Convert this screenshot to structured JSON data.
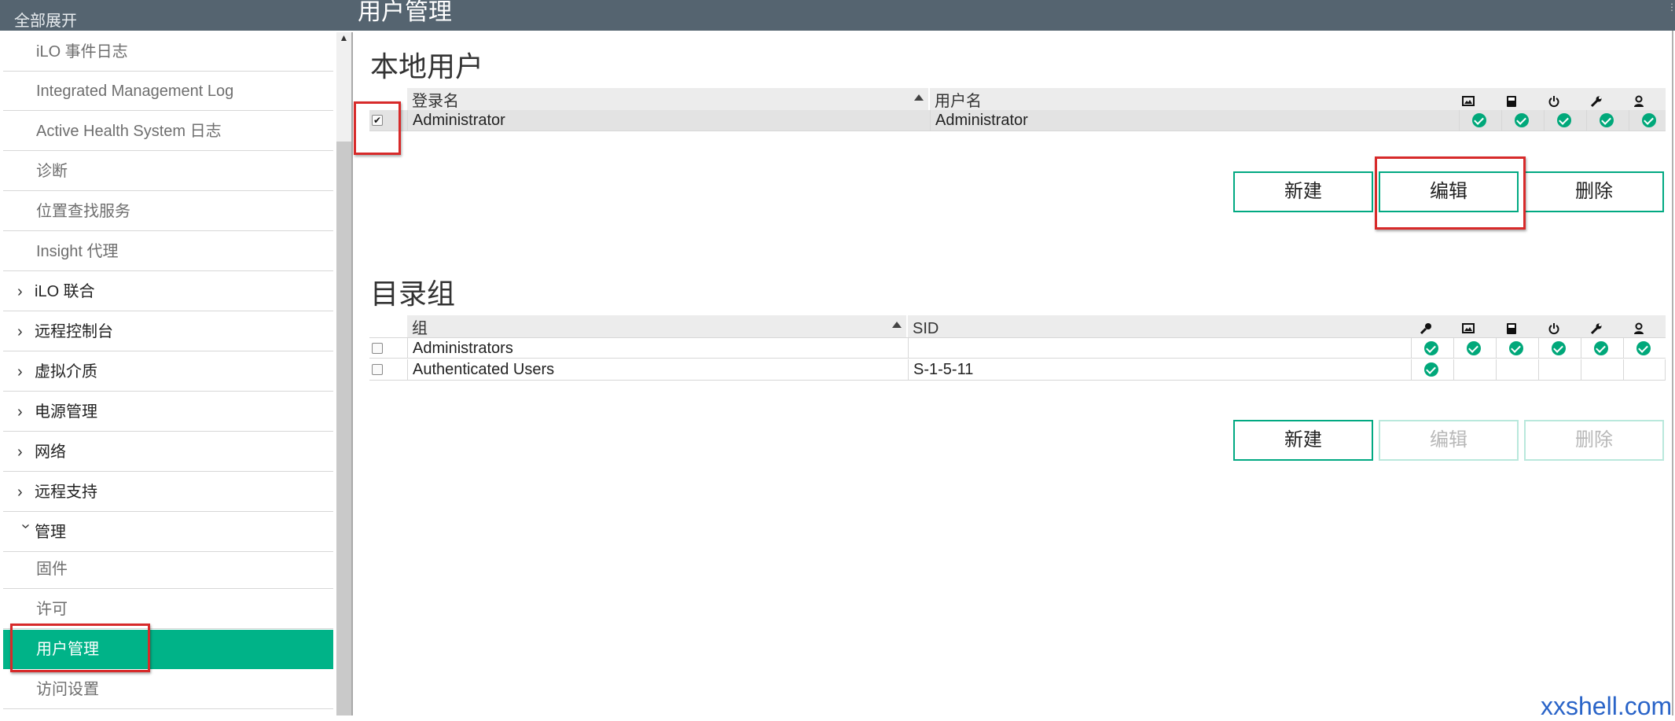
{
  "topbar": {
    "expand_all": "全部展开",
    "page_title": "用户管理"
  },
  "sidebar": {
    "items": [
      {
        "label": "iLO 事件日志",
        "kind": "child"
      },
      {
        "label": "Integrated Management Log",
        "kind": "child"
      },
      {
        "label": "Active Health System 日志",
        "kind": "child"
      },
      {
        "label": "诊断",
        "kind": "child"
      },
      {
        "label": "位置查找服务",
        "kind": "child"
      },
      {
        "label": "Insight 代理",
        "kind": "child"
      },
      {
        "label": "iLO 联合",
        "kind": "parent",
        "state": "collapsed"
      },
      {
        "label": "远程控制台",
        "kind": "parent",
        "state": "collapsed"
      },
      {
        "label": "虚拟介质",
        "kind": "parent",
        "state": "collapsed"
      },
      {
        "label": "电源管理",
        "kind": "parent",
        "state": "collapsed"
      },
      {
        "label": "网络",
        "kind": "parent",
        "state": "collapsed"
      },
      {
        "label": "远程支持",
        "kind": "parent",
        "state": "collapsed"
      },
      {
        "label": "管理",
        "kind": "parent",
        "state": "expanded"
      },
      {
        "label": "固件",
        "kind": "child"
      },
      {
        "label": "许可",
        "kind": "child"
      },
      {
        "label": "用户管理",
        "kind": "child",
        "active": true
      },
      {
        "label": "访问设置",
        "kind": "child"
      }
    ]
  },
  "local_users": {
    "title": "本地用户",
    "columns": {
      "login": "登录名",
      "username": "用户名"
    },
    "privilege_icons": [
      "remote-console-icon",
      "virtual-media-icon",
      "power-icon",
      "config-icon",
      "user-admin-icon"
    ],
    "rows": [
      {
        "checked": true,
        "login": "Administrator",
        "username": "Administrator",
        "privileges": [
          true,
          true,
          true,
          true,
          true
        ]
      }
    ],
    "buttons": {
      "new": "新建",
      "edit": "编辑",
      "delete": "删除"
    }
  },
  "directory_groups": {
    "title": "目录组",
    "columns": {
      "group": "组",
      "sid": "SID"
    },
    "privilege_icons": [
      "login-key-icon",
      "remote-console-icon",
      "virtual-media-icon",
      "power-icon",
      "config-icon",
      "user-admin-icon"
    ],
    "rows": [
      {
        "checked": false,
        "group": "Administrators",
        "sid": "",
        "privileges": [
          true,
          true,
          true,
          true,
          true,
          true
        ]
      },
      {
        "checked": false,
        "group": "Authenticated Users",
        "sid": "S-1-5-11",
        "privileges": [
          true,
          false,
          false,
          false,
          false,
          false
        ]
      }
    ],
    "buttons": {
      "new": "新建",
      "edit": "编辑",
      "delete": "删除"
    },
    "edit_disabled": true,
    "delete_disabled": true
  },
  "watermark": "xxshell.com",
  "colors": {
    "accent": "#00b388",
    "header": "#556470",
    "annotation": "#d72a2a"
  }
}
